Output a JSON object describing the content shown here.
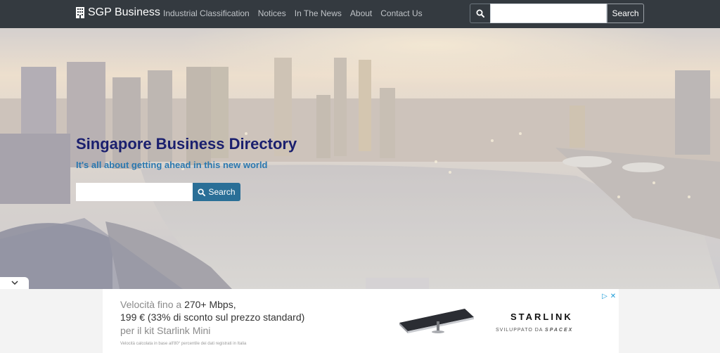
{
  "navbar": {
    "brand": "SGP Business",
    "links": [
      "Industrial Classification",
      "Notices",
      "In The News",
      "About",
      "Contact Us"
    ],
    "search_value": "",
    "search_button": "Search"
  },
  "hero": {
    "title": "Singapore Business Directory",
    "subtitle": "It's all about getting ahead in this new world",
    "search_value": "",
    "search_button": "Search"
  },
  "ad": {
    "line1_prefix": "Velocità fino a ",
    "line1_highlight": "270+ Mbps,",
    "line2": "199 € (33% di sconto sul prezzo standard)",
    "line3": "per il kit Starlink Mini",
    "fine_print": "Velocità calcolata in base all'80° percentile dei dati registrati in Italia",
    "brand": "STARLINK",
    "developed_by": "SVILUPPATO DA",
    "developer": "SPACEX",
    "choices_icon": "ad-choices-icon",
    "close_icon": "close-icon"
  },
  "colors": {
    "navbar_bg": "#343a40",
    "hero_title": "#1a1f6e",
    "hero_subtitle": "#2a78b0",
    "search_button": "#2a6f97"
  }
}
